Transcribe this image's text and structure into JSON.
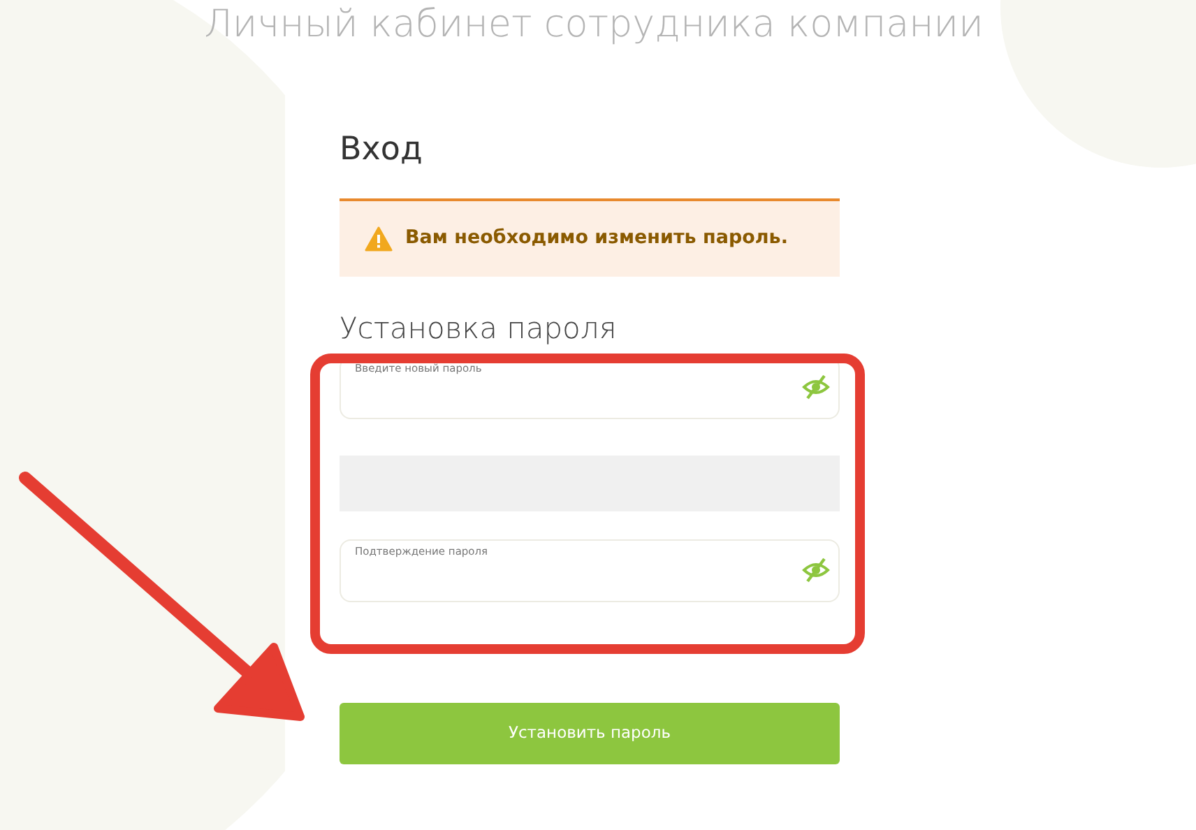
{
  "page_title": "Личный кабинет сотрудника компании",
  "card": {
    "heading": "Вход",
    "alert": {
      "kind": "warning",
      "text": "Вам необходимо изменить пароль."
    },
    "section_title": "Установка пароля",
    "fields": [
      {
        "kind": "password",
        "label": "Введите новый пароль"
      },
      {
        "kind": "spacer"
      },
      {
        "kind": "password",
        "label": "Подтверждение пароля"
      }
    ],
    "submit_button": "Установить пароль"
  },
  "annotations": {
    "highlight": true,
    "arrow": true
  }
}
